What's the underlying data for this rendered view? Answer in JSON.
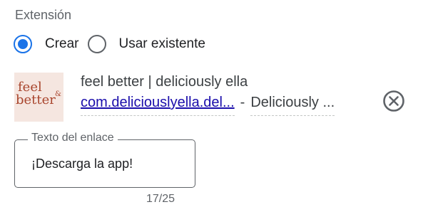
{
  "section": {
    "label": "Extensión"
  },
  "radios": [
    {
      "label": "Crear",
      "checked": true
    },
    {
      "label": "Usar existente",
      "checked": false
    }
  ],
  "app": {
    "icon_text_1": "feel",
    "icon_text_2": "better",
    "icon_text_3": "&",
    "title": "feel better | deliciously ella",
    "package": "com.deliciouslyella.del...",
    "separator": "-",
    "developer": "Deliciously ..."
  },
  "link_text_field": {
    "label": "Texto del enlace",
    "value": "¡Descarga la app!",
    "counter": "17/25"
  },
  "colors": {
    "accent": "#1a73e8",
    "link": "#1a0dab",
    "muted": "#5f6368"
  },
  "icons": {
    "remove": "close-circle-icon"
  }
}
